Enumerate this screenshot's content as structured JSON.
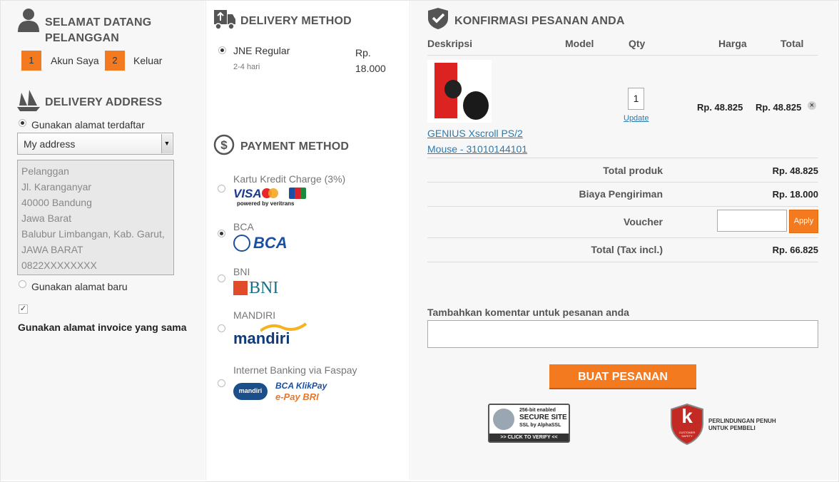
{
  "welcome": {
    "title_line1": "SELAMAT DATANG",
    "title_line2": "PELANGGAN",
    "menu": [
      {
        "num": "1",
        "label": "Akun Saya"
      },
      {
        "num": "2",
        "label": "Keluar"
      }
    ]
  },
  "delivery_address": {
    "title": "DELIVERY ADDRESS",
    "option_registered": "Gunakan alamat terdaftar",
    "selected_address": "My address",
    "address_lines": [
      "Pelanggan",
      "Jl. Karanganyar",
      "40000 Bandung",
      "Jawa Barat",
      "Balubur Limbangan, Kab. Garut,",
      "JAWA BARAT",
      "0822XXXXXXXX"
    ],
    "option_new": "Gunakan alamat baru",
    "same_invoice_label": "Gunakan alamat invoice yang sama"
  },
  "delivery_method": {
    "title": "DELIVERY METHOD",
    "carrier": "JNE Regular",
    "eta": "2-4 hari",
    "price_line1": "Rp.",
    "price_line2": "18.000"
  },
  "payment_method": {
    "title": "PAYMENT METHOD",
    "options": [
      {
        "label": "Kartu Kredit Charge (3%)",
        "logo_text": "VISA",
        "logo_sub": "powered by veritrans"
      },
      {
        "label": "BCA",
        "logo_text": "BCA"
      },
      {
        "label": "BNI",
        "logo_text": "BNI"
      },
      {
        "label": "MANDIRI",
        "logo_text": "mandiri"
      },
      {
        "label": "Internet Banking via Faspay",
        "logo_text": "mandiri",
        "logo_sub1": "BCA KlikPay",
        "logo_sub2": "e-Pay BRI"
      }
    ]
  },
  "order": {
    "title": "KONFIRMASI PESANAN ANDA",
    "columns": {
      "desc": "Deskripsi",
      "model": "Model",
      "qty": "Qty",
      "price": "Harga",
      "total": "Total"
    },
    "item": {
      "name_line1": "GENIUS Xscroll PS/2",
      "name_line2": "Mouse - 31010144101",
      "qty": "1",
      "update_label": "Update",
      "price": "Rp. 48.825",
      "total": "Rp. 48.825",
      "remove_icon": "×"
    },
    "summary": {
      "products_label": "Total produk",
      "products_value": "Rp. 48.825",
      "shipping_label": "Biaya Pengiriman",
      "shipping_value": "Rp. 18.000",
      "voucher_label": "Voucher",
      "apply_label": "Apply",
      "total_label": "Total (Tax incl.)",
      "total_value": "Rp. 66.825"
    },
    "comment_label": "Tambahkan komentar untuk pesanan anda",
    "submit_label": "BUAT PESANAN"
  },
  "badges": {
    "ssl": {
      "line1": "256-bit enabled",
      "line2": "SECURE SITE",
      "line3": "SSL by AlphaSSL",
      "line4": ">> CLICK TO VERIFY <<"
    },
    "protection": {
      "line1": "PERLINDUNGAN PENUH",
      "line2": "UNTUK PEMBELI",
      "shield_letter": "k",
      "shield_sub": "CUSTOMER SAFETY"
    }
  },
  "colors": {
    "accent": "#f47a20",
    "link": "#2a7ab0"
  }
}
